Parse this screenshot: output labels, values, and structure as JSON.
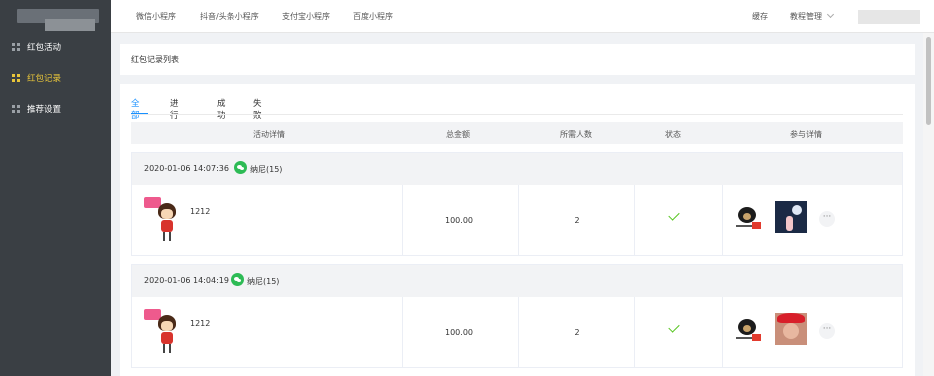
{
  "topnav": {
    "items": [
      {
        "label": "微信小程序"
      },
      {
        "label": "抖音/头条小程序"
      },
      {
        "label": "支付宝小程序"
      },
      {
        "label": "百度小程序"
      }
    ],
    "cache_label": "缓存",
    "tutorial_label": "教程管理"
  },
  "sidebar": {
    "items": [
      {
        "label": "红包活动",
        "active": false
      },
      {
        "label": "红包记录",
        "active": true
      },
      {
        "label": "推荐设置",
        "active": false
      }
    ]
  },
  "page": {
    "title": "红包记录列表",
    "tabs": [
      {
        "label": "全部",
        "active": true
      },
      {
        "label": "进行中",
        "active": false
      },
      {
        "label": "成功",
        "active": false
      },
      {
        "label": "失败",
        "active": false
      }
    ],
    "columns": [
      "活动详情",
      "总金额",
      "所需人数",
      "状态",
      "参与详情"
    ]
  },
  "orders": [
    {
      "time": "2020-01-06 14:07:36",
      "user": "纳尼(15)",
      "activity": "1212",
      "amount": "100.00",
      "people": "2",
      "status": "success",
      "more": "···"
    },
    {
      "time": "2020-01-06 14:04:19",
      "user": "纳尼(15)",
      "activity": "1212",
      "amount": "100.00",
      "people": "2",
      "status": "success",
      "more": "···"
    }
  ],
  "colors": {
    "sidebar_bg": "#3a3f44",
    "active_nav": "#e8c53a",
    "tab_active": "#1890ff",
    "success": "#52c41a",
    "wechat": "#2dbb55"
  }
}
